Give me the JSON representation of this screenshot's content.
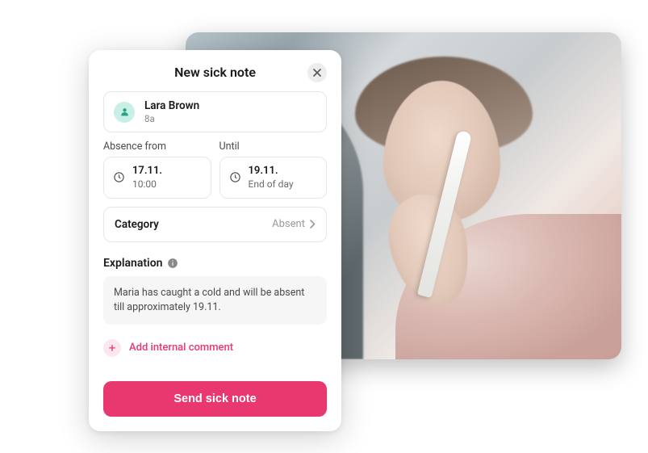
{
  "header": {
    "title": "New sick note"
  },
  "person": {
    "name": "Lara Brown",
    "class": "8a"
  },
  "absence": {
    "from_label": "Absence from",
    "until_label": "Until",
    "from_date": "17.11.",
    "from_time": "10:00",
    "until_date": "19.11.",
    "until_time": "End of day"
  },
  "category": {
    "label": "Category",
    "value": "Absent"
  },
  "explanation": {
    "label": "Explanation",
    "text": "Maria has caught a cold and will be absent till approximately 19.11."
  },
  "actions": {
    "add_comment": "Add internal comment",
    "send": "Send sick note"
  }
}
